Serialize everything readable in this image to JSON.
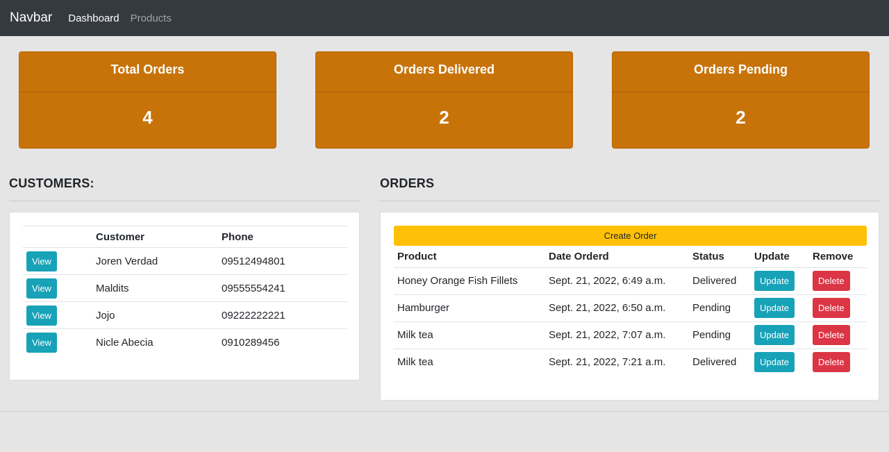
{
  "navbar": {
    "brand": "Navbar",
    "links": [
      {
        "label": "Dashboard",
        "active": true
      },
      {
        "label": "Products",
        "active": false
      }
    ]
  },
  "stats": [
    {
      "title": "Total Orders",
      "value": "4"
    },
    {
      "title": "Orders Delivered",
      "value": "2"
    },
    {
      "title": "Orders Pending",
      "value": "2"
    }
  ],
  "customers": {
    "title": "CUSTOMERS:",
    "headers": [
      "",
      "Customer",
      "Phone"
    ],
    "view_label": "View",
    "rows": [
      {
        "name": "Joren Verdad",
        "phone": "09512494801"
      },
      {
        "name": "Maldits",
        "phone": "09555554241"
      },
      {
        "name": "Jojo",
        "phone": "09222222221"
      },
      {
        "name": "Nicle Abecia",
        "phone": "0910289456"
      }
    ]
  },
  "orders": {
    "title": "ORDERS",
    "create_label": "Create Order",
    "headers": [
      "Product",
      "Date Orderd",
      "Status",
      "Update",
      "Remove"
    ],
    "update_label": "Update",
    "delete_label": "Delete",
    "rows": [
      {
        "product": "Honey Orange Fish Fillets",
        "date": "Sept. 21, 2022, 6:49 a.m.",
        "status": "Delivered"
      },
      {
        "product": "Hamburger",
        "date": "Sept. 21, 2022, 6:50 a.m.",
        "status": "Pending"
      },
      {
        "product": "Milk tea",
        "date": "Sept. 21, 2022, 7:07 a.m.",
        "status": "Pending"
      },
      {
        "product": "Milk tea",
        "date": "Sept. 21, 2022, 7:21 a.m.",
        "status": "Delivered"
      }
    ]
  },
  "colors": {
    "navbar": "#343a40",
    "card": "#c8730a",
    "info": "#17a2b8",
    "danger": "#dc3545",
    "warning": "#ffc107"
  }
}
